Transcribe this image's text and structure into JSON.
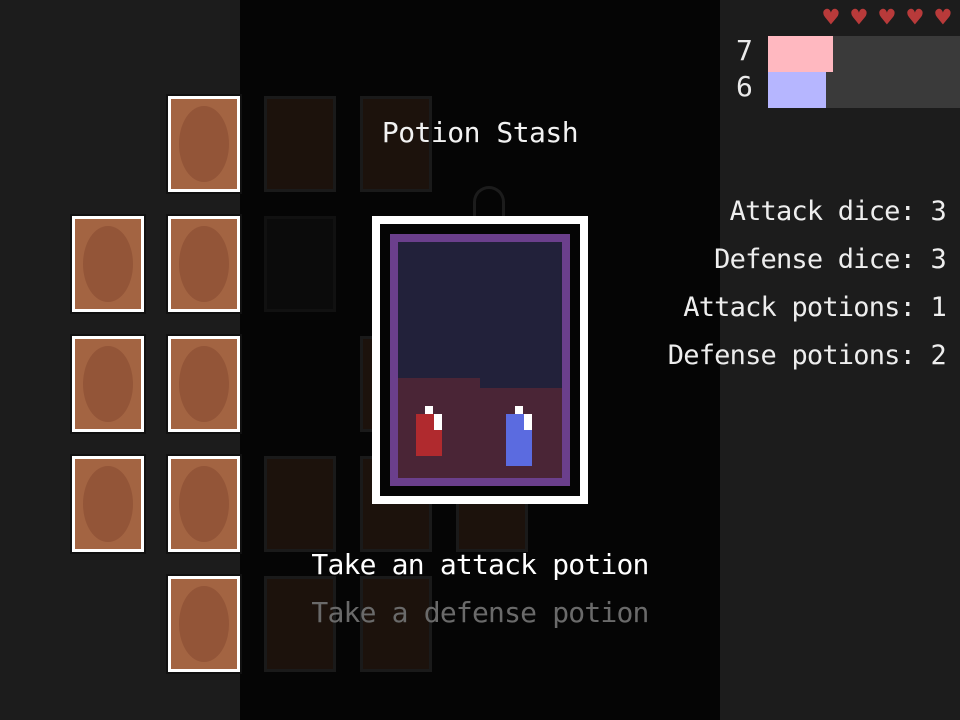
{
  "panel": {
    "title": "Potion Stash"
  },
  "options": [
    {
      "label": "Take an attack potion",
      "selected": true
    },
    {
      "label": "Take a defense potion",
      "selected": false
    }
  ],
  "player": {
    "hearts": 5,
    "heart_color": "#b83a3a",
    "attack_value": "7",
    "defense_value": "6",
    "attack_bar_fraction": 0.34,
    "defense_bar_fraction": 0.3,
    "attack_color": "#ffb8c0",
    "defense_color": "#b6b6ff"
  },
  "stats": {
    "attack_dice": "Attack dice: 3",
    "defense_dice": "Defense dice: 3",
    "attack_potions": "Attack potions: 1",
    "defense_potions": "Defense potions: 2"
  },
  "icons": {
    "heart": "heart-icon",
    "attack_potion": "red-potion-icon",
    "defense_potion": "blue-potion-icon",
    "card_back": "card-back-icon"
  }
}
